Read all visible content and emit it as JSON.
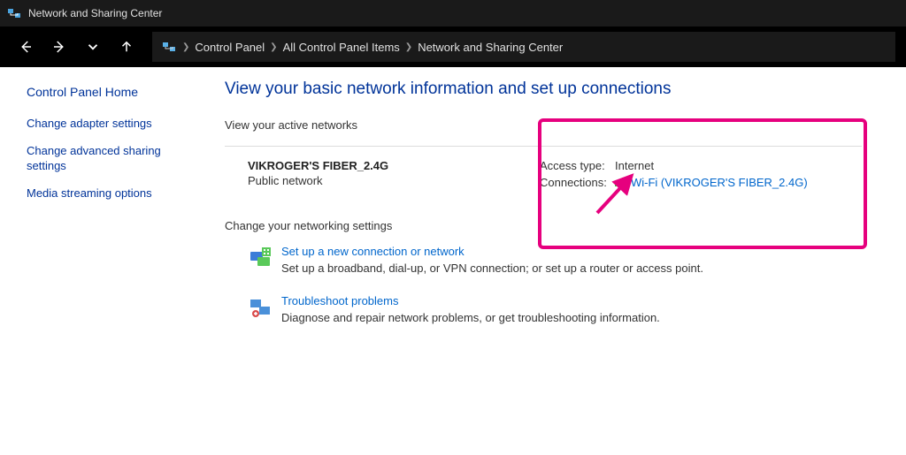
{
  "titlebar": {
    "title": "Network and Sharing Center"
  },
  "breadcrumbs": {
    "items": [
      "Control Panel",
      "All Control Panel Items",
      "Network and Sharing Center"
    ]
  },
  "sidebar": {
    "home": "Control Panel Home",
    "links": [
      "Change adapter settings",
      "Change advanced sharing settings",
      "Media streaming options"
    ]
  },
  "main": {
    "title": "View your basic network information and set up connections",
    "active_label": "View your active networks",
    "network": {
      "name": "VIKROGER'S FIBER_2.4G",
      "type": "Public network",
      "access_label": "Access type:",
      "access_value": "Internet",
      "conn_label": "Connections:",
      "conn_link": "Wi-Fi (VIKROGER'S FIBER_2.4G)"
    },
    "change_label": "Change your networking settings",
    "settings": [
      {
        "link": "Set up a new connection or network",
        "desc": "Set up a broadband, dial-up, or VPN connection; or set up a router or access point."
      },
      {
        "link": "Troubleshoot problems",
        "desc": "Diagnose and repair network problems, or get troubleshooting information."
      }
    ]
  }
}
